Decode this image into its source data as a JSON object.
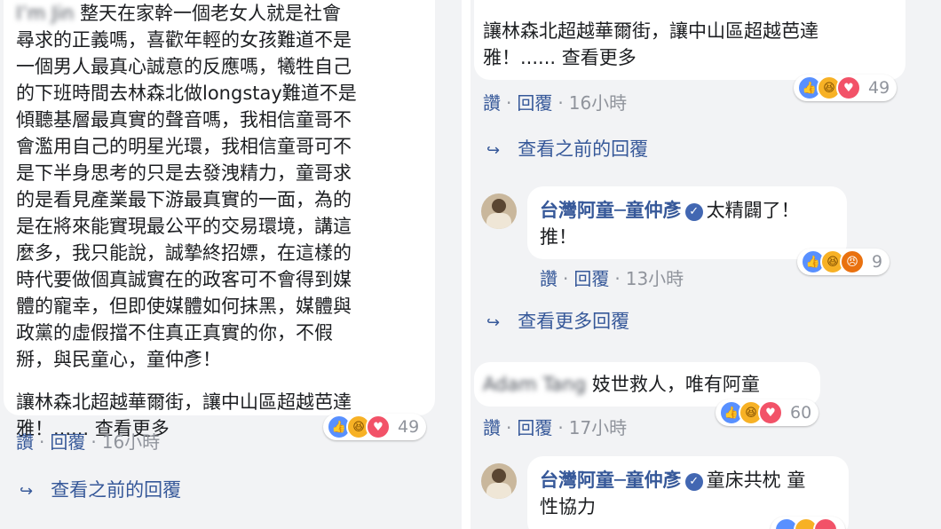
{
  "left": {
    "main_comment": {
      "blurred_name": "I’m Jin",
      "lines": [
        "整天在家幹一個老女人就是社會",
        "尋求的正義嗎，喜歡年輕的女孩難道不是",
        "一個男人最真心誠意的反應嗎，犧牲自己",
        "的下班時間去林森北做longstay難道不是",
        "傾聽基層最真實的聲音嗎，我相信童哥不",
        "會濫用自己的明星光環，我相信童哥可不",
        "是下半身思考的只是去發洩精力，童哥求",
        "的是看見產業最下游最真實的一面，為的",
        "是在將來能實現最公平的交易環境，講這",
        "麼多，我只能說，誠摯終招嫖，在這樣的",
        "時代要做個真誠實在的政客可不會得到媒",
        "體的寵幸，但即使媒體如何抹黑，媒體與",
        "政黨的虛假擋不住真正真實的你，不假",
        "掰，與民童心，童仲彥！"
      ],
      "closing_lines": [
        "讓林森北超越華爾街，讓中山區超越芭達",
        "雅！"
      ],
      "ellipsis": "......",
      "see_more": "查看更多",
      "reaction_count": "49",
      "actions": {
        "like": "讚",
        "reply": "回覆",
        "time": "16小時"
      }
    },
    "view_previous": "查看之前的回覆"
  },
  "right": {
    "top_comment": {
      "lines": [
        "讓林森北超越華爾街，讓中山區超越芭達",
        "雅！"
      ],
      "ellipsis": "......",
      "see_more": "查看更多",
      "reaction_count": "49",
      "actions": {
        "like": "讚",
        "reply": "回覆",
        "time": "16小時"
      }
    },
    "view_previous": "查看之前的回覆",
    "reply_1": {
      "author": "台灣阿童─童仲彥",
      "text_line1": "太精闢了！",
      "text_line2": "推！",
      "reaction_count": "9",
      "actions": {
        "like": "讚",
        "reply": "回覆",
        "time": "13小時"
      }
    },
    "view_more": "查看更多回覆",
    "comment_2": {
      "blurred_name": "Adam Tang",
      "text": "妓世救人，唯有阿童",
      "reaction_count": "60",
      "actions": {
        "like": "讚",
        "reply": "回覆",
        "time": "17小時"
      }
    },
    "reply_2": {
      "author": "台灣阿童─童仲彥",
      "text_line1": "童床共枕 童",
      "text_line2": "性協力"
    }
  },
  "icons": {
    "verified": "verified-check-icon",
    "reply_arrow": "reply-arrow-icon",
    "like": "like-reaction-icon",
    "haha": "haha-reaction-icon",
    "love": "love-reaction-icon",
    "angry": "angry-reaction-icon"
  },
  "colors": {
    "link": "#365899",
    "meta": "#90949c",
    "like": "#5890ff",
    "love": "#f25268",
    "haha": "#f7b125"
  }
}
